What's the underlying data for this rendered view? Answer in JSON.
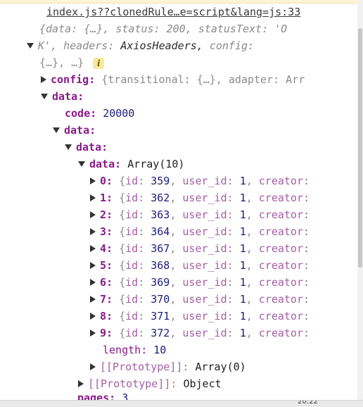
{
  "source": "index.js??clonedRule…e=script&lang=js:33",
  "summary": {
    "line1": "{data: {…}, status: 200, statusText: 'O",
    "line2_key_headers": "K', headers:",
    "headers_value": "AxiosHeaders,",
    "config_key": "config:",
    "line3": "{…}, …}",
    "info_badge": "i"
  },
  "config_row": {
    "key": "config",
    "value": "{transitional: {…}, adapter: Arr"
  },
  "data_root": {
    "key": "data"
  },
  "code_row": {
    "key": "code",
    "value": "20000"
  },
  "data_level2": {
    "key": "data"
  },
  "data_level3": {
    "key": "data"
  },
  "data_array": {
    "key": "data",
    "value": "Array(10)"
  },
  "items": [
    {
      "index": "0",
      "id": "359",
      "user_id": "1"
    },
    {
      "index": "1",
      "id": "362",
      "user_id": "1"
    },
    {
      "index": "2",
      "id": "363",
      "user_id": "1"
    },
    {
      "index": "3",
      "id": "364",
      "user_id": "1"
    },
    {
      "index": "4",
      "id": "367",
      "user_id": "1"
    },
    {
      "index": "5",
      "id": "368",
      "user_id": "1"
    },
    {
      "index": "6",
      "id": "369",
      "user_id": "1"
    },
    {
      "index": "7",
      "id": "370",
      "user_id": "1"
    },
    {
      "index": "8",
      "id": "371",
      "user_id": "1"
    },
    {
      "index": "9",
      "id": "372",
      "user_id": "1"
    }
  ],
  "item_labels": {
    "id": "id",
    "user_id": "user_id",
    "creator": "creator:"
  },
  "length_row": {
    "key": "length",
    "value": "10"
  },
  "prototype_array": {
    "key": "[[Prototype]]",
    "value": "Array(0)"
  },
  "prototype_object": {
    "key": "[[Prototype]]",
    "value": "Object"
  },
  "pages_row": {
    "key": "pages",
    "value": "3"
  },
  "taskbar": {
    "clock": "20:22"
  },
  "colors": {
    "key": "#8a1a8a",
    "number": "#1c1c7c",
    "string": "#c0392b",
    "muted": "#8a8a8a"
  }
}
